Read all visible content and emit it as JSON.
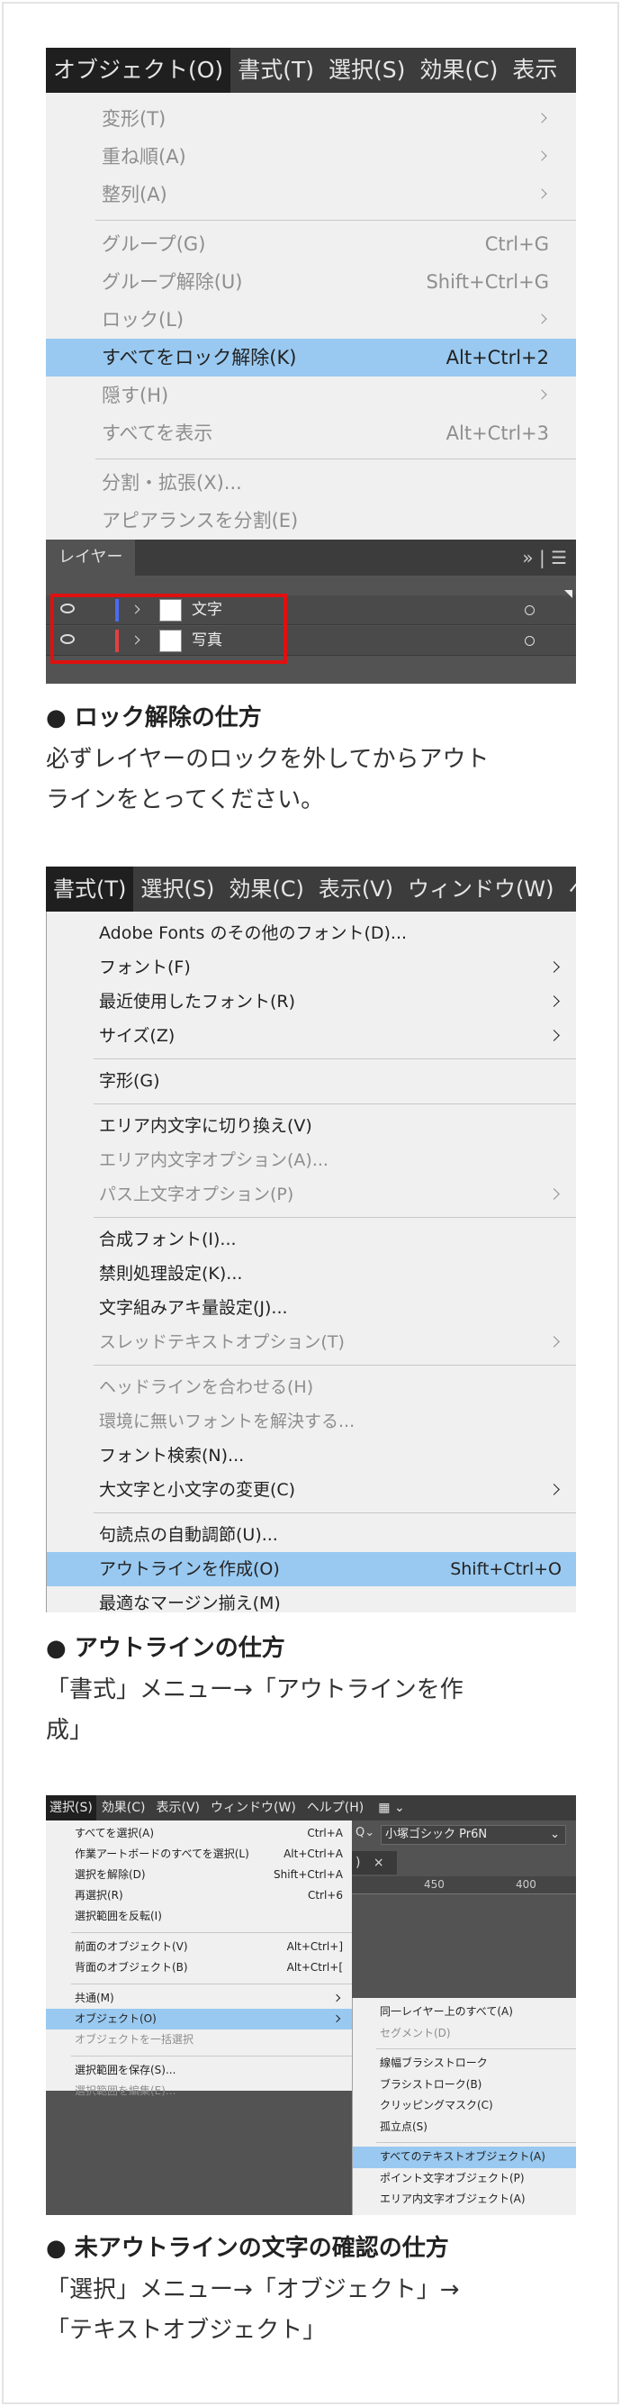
{
  "shot1": {
    "menubar": [
      "オブジェクト(O)",
      "書式(T)",
      "選択(S)",
      "効果(C)",
      "表示"
    ],
    "items": [
      {
        "label": "変形(T)",
        "shortcut": "",
        "submenu": true,
        "disabled": true
      },
      {
        "label": "重ね順(A)",
        "shortcut": "",
        "submenu": true,
        "disabled": true
      },
      {
        "label": "整列(A)",
        "shortcut": "",
        "submenu": true,
        "disabled": true
      },
      {
        "label": "グループ(G)",
        "shortcut": "Ctrl+G",
        "submenu": false,
        "disabled": true
      },
      {
        "label": "グループ解除(U)",
        "shortcut": "Shift+Ctrl+G",
        "submenu": false,
        "disabled": true
      },
      {
        "label": "ロック(L)",
        "shortcut": "",
        "submenu": true,
        "disabled": true
      },
      {
        "label": "すべてをロック解除(K)",
        "shortcut": "Alt+Ctrl+2",
        "submenu": false,
        "disabled": false,
        "highlighted": true
      },
      {
        "label": "隠す(H)",
        "shortcut": "",
        "submenu": true,
        "disabled": true
      },
      {
        "label": "すべてを表示",
        "shortcut": "Alt+Ctrl+3",
        "submenu": false,
        "disabled": true
      },
      {
        "label": "分割・拡張(X)...",
        "shortcut": "",
        "submenu": false,
        "disabled": true
      },
      {
        "label": "アピアランスを分割(E)",
        "shortcut": "",
        "submenu": false,
        "disabled": true
      }
    ],
    "layers_tab": "レイヤー",
    "panel_menu_glyph": "»",
    "layers": [
      {
        "name": "文字",
        "color": "#4a6cf0"
      },
      {
        "name": "写真",
        "color": "#e04040"
      }
    ],
    "highlight_color": "#e01010"
  },
  "section1": {
    "heading": "● ロック解除の仕方",
    "lines": [
      "必ずレイヤーのロックを外してからアウト",
      "ラインをとってください。"
    ]
  },
  "shot2": {
    "menubar": [
      "書式(T)",
      "選択(S)",
      "効果(C)",
      "表示(V)",
      "ウィンドウ(W)",
      "ヘ"
    ],
    "items": [
      {
        "label": "Adobe Fonts のその他のフォント(D)...",
        "shortcut": "",
        "submenu": false,
        "disabled": false
      },
      {
        "label": "フォント(F)",
        "shortcut": "",
        "submenu": true,
        "disabled": false
      },
      {
        "label": "最近使用したフォント(R)",
        "shortcut": "",
        "submenu": true,
        "disabled": false
      },
      {
        "label": "サイズ(Z)",
        "shortcut": "",
        "submenu": true,
        "disabled": false
      },
      {
        "label": "字形(G)",
        "shortcut": "",
        "submenu": false,
        "disabled": false
      },
      {
        "label": "エリア内文字に切り換え(V)",
        "shortcut": "",
        "submenu": false,
        "disabled": false
      },
      {
        "label": "エリア内文字オプション(A)...",
        "shortcut": "",
        "submenu": false,
        "disabled": true
      },
      {
        "label": "パス上文字オプション(P)",
        "shortcut": "",
        "submenu": true,
        "disabled": true
      },
      {
        "label": "合成フォント(I)...",
        "shortcut": "",
        "submenu": false,
        "disabled": false
      },
      {
        "label": "禁則処理設定(K)...",
        "shortcut": "",
        "submenu": false,
        "disabled": false
      },
      {
        "label": "文字組みアキ量設定(J)...",
        "shortcut": "",
        "submenu": false,
        "disabled": false
      },
      {
        "label": "スレッドテキストオプション(T)",
        "shortcut": "",
        "submenu": true,
        "disabled": true
      },
      {
        "label": "ヘッドラインを合わせる(H)",
        "shortcut": "",
        "submenu": false,
        "disabled": true
      },
      {
        "label": "環境に無いフォントを解決する...",
        "shortcut": "",
        "submenu": false,
        "disabled": true
      },
      {
        "label": "フォント検索(N)...",
        "shortcut": "",
        "submenu": false,
        "disabled": false
      },
      {
        "label": "大文字と小文字の変更(C)",
        "shortcut": "",
        "submenu": true,
        "disabled": false
      },
      {
        "label": "句読点の自動調節(U)...",
        "shortcut": "",
        "submenu": false,
        "disabled": false
      },
      {
        "label": "アウトラインを作成(O)",
        "shortcut": "Shift+Ctrl+O",
        "submenu": false,
        "disabled": false,
        "highlighted": true
      },
      {
        "label": "最適なマージン揃え(M)",
        "shortcut": "",
        "submenu": false,
        "disabled": false
      }
    ]
  },
  "section2": {
    "heading": "● アウトラインの仕方",
    "lines": [
      "「書式」メニュー→「アウトラインを作",
      "成」"
    ]
  },
  "shot3": {
    "menubar": [
      "選択(S)",
      "効果(C)",
      "表示(V)",
      "ウィンドウ(W)",
      "ヘルプ(H)",
      "▦ ⌄"
    ],
    "font_field": "小塚ゴシック Pr6N",
    "font_prefix": "Q⌄",
    "ruler_labels": [
      "450",
      "400"
    ],
    "close_glyph": "×",
    "items": [
      {
        "label": "すべてを選択(A)",
        "shortcut": "Ctrl+A",
        "submenu": false,
        "disabled": false
      },
      {
        "label": "作業アートボードのすべてを選択(L)",
        "shortcut": "Alt+Ctrl+A",
        "submenu": false,
        "disabled": false
      },
      {
        "label": "選択を解除(D)",
        "shortcut": "Shift+Ctrl+A",
        "submenu": false,
        "disabled": false
      },
      {
        "label": "再選択(R)",
        "shortcut": "Ctrl+6",
        "submenu": false,
        "disabled": false
      },
      {
        "label": "選択範囲を反転(I)",
        "shortcut": "",
        "submenu": false,
        "disabled": false
      },
      {
        "label": "前面のオブジェクト(V)",
        "shortcut": "Alt+Ctrl+]",
        "submenu": false,
        "disabled": false
      },
      {
        "label": "背面のオブジェクト(B)",
        "shortcut": "Alt+Ctrl+[",
        "submenu": false,
        "disabled": false
      },
      {
        "label": "共通(M)",
        "shortcut": "",
        "submenu": true,
        "disabled": false
      },
      {
        "label": "オブジェクト(O)",
        "shortcut": "",
        "submenu": true,
        "disabled": false,
        "highlighted": true
      },
      {
        "label": "オブジェクトを一括選択",
        "shortcut": "",
        "submenu": false,
        "disabled": true
      },
      {
        "label": "選択範囲を保存(S)...",
        "shortcut": "",
        "submenu": false,
        "disabled": false
      },
      {
        "label": "選択範囲を編集(E)...",
        "shortcut": "",
        "submenu": false,
        "disabled": true
      }
    ],
    "sub_items": [
      {
        "label": "同一レイヤー上のすべて(A)",
        "disabled": false
      },
      {
        "label": "セグメント(D)",
        "disabled": true
      },
      {
        "label": "線幅ブラシストローク",
        "disabled": false
      },
      {
        "label": "ブラシストローク(B)",
        "disabled": false
      },
      {
        "label": "クリッピングマスク(C)",
        "disabled": false
      },
      {
        "label": "孤立点(S)",
        "disabled": false
      },
      {
        "label": "すべてのテキストオブジェクト(A)",
        "disabled": false,
        "highlighted": true
      },
      {
        "label": "ポイント文字オブジェクト(P)",
        "disabled": false
      },
      {
        "label": "エリア内文字オブジェクト(A)",
        "disabled": false
      }
    ]
  },
  "section3": {
    "heading": "● 未アウトラインの文字の確認の仕方",
    "lines": [
      "「選択」メニュー→「オブジェクト」→",
      "「テキストオブジェクト」"
    ]
  }
}
